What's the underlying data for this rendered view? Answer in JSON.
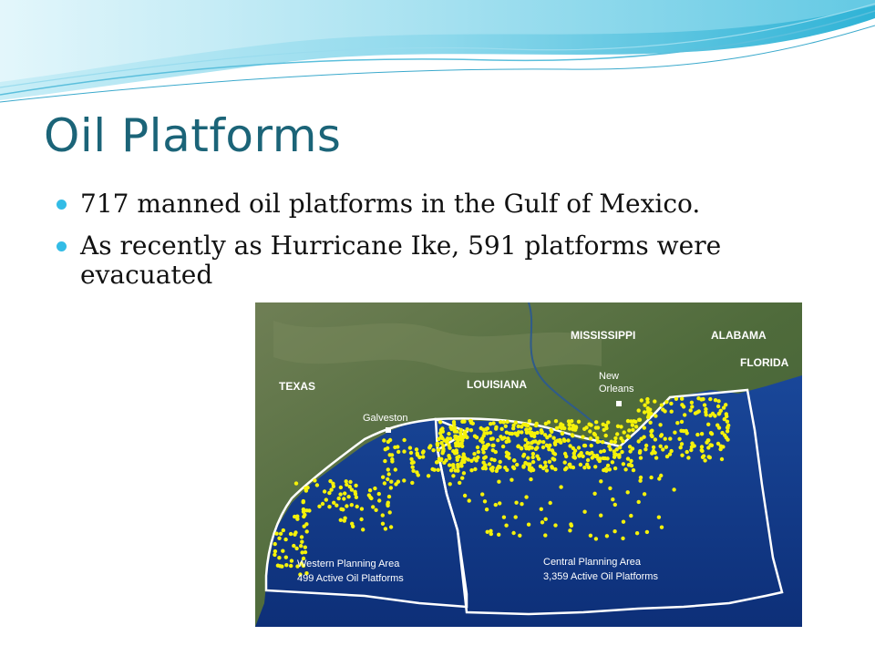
{
  "slide": {
    "title": "Oil Platforms",
    "bullets": [
      "717 manned oil platforms in the Gulf of Mexico.",
      "As recently as Hurricane Ike, 591 platforms were evacuated"
    ]
  },
  "map": {
    "states": [
      "TEXAS",
      "LOUISIANA",
      "MISSISSIPPI",
      "ALABAMA",
      "FLORIDA"
    ],
    "cities": {
      "galveston": "Galveston",
      "new_orleans_line1": "New",
      "new_orleans_line2": "Orleans"
    },
    "areas": {
      "western": {
        "name": "Western Planning Area",
        "count": "499 Active Oil Platforms"
      },
      "central": {
        "name": "Central Planning Area",
        "count": "3,359 Active Oil Platforms"
      }
    },
    "colors": {
      "platform": "#f5f20a",
      "water": "#123a8c",
      "land": "#4d6a3a",
      "boundary": "#ffffff"
    }
  }
}
